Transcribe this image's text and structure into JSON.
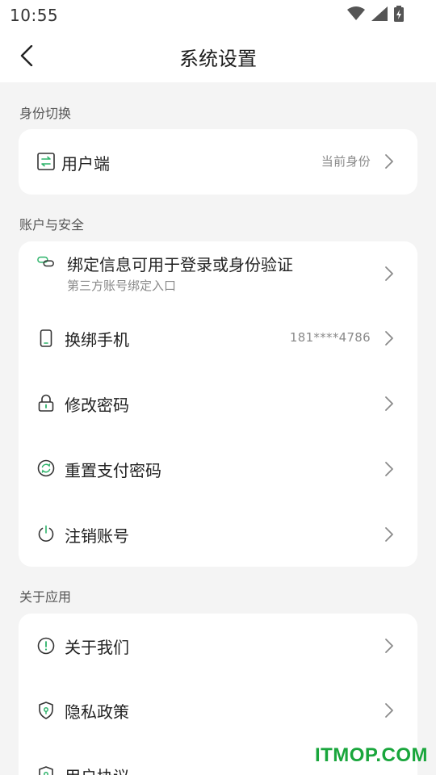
{
  "status_bar": {
    "time": "10:55"
  },
  "header": {
    "title": "系统设置"
  },
  "sections": {
    "identity": {
      "label": "身份切换",
      "items": [
        {
          "label": "用户端",
          "value": "当前身份",
          "icon": "switch-icon"
        }
      ]
    },
    "account": {
      "label": "账户与安全",
      "items": [
        {
          "label": "绑定信息可用于登录或身份验证",
          "sub": "第三方账号绑定入口",
          "icon": "link-icon"
        },
        {
          "label": "换绑手机",
          "value": "181****4786",
          "icon": "phone-icon"
        },
        {
          "label": "修改密码",
          "icon": "lock-icon"
        },
        {
          "label": "重置支付密码",
          "icon": "refresh-icon"
        },
        {
          "label": "注销账号",
          "icon": "power-icon"
        }
      ]
    },
    "about": {
      "label": "关于应用",
      "items": [
        {
          "label": "关于我们",
          "icon": "info-icon"
        },
        {
          "label": "隐私政策",
          "icon": "shield-icon"
        },
        {
          "label": "用户协议",
          "icon": "shield-icon"
        }
      ]
    }
  },
  "watermark": "ITMOP.COM",
  "colors": {
    "accent": "#19a63c",
    "icon_green": "#2db36a"
  }
}
